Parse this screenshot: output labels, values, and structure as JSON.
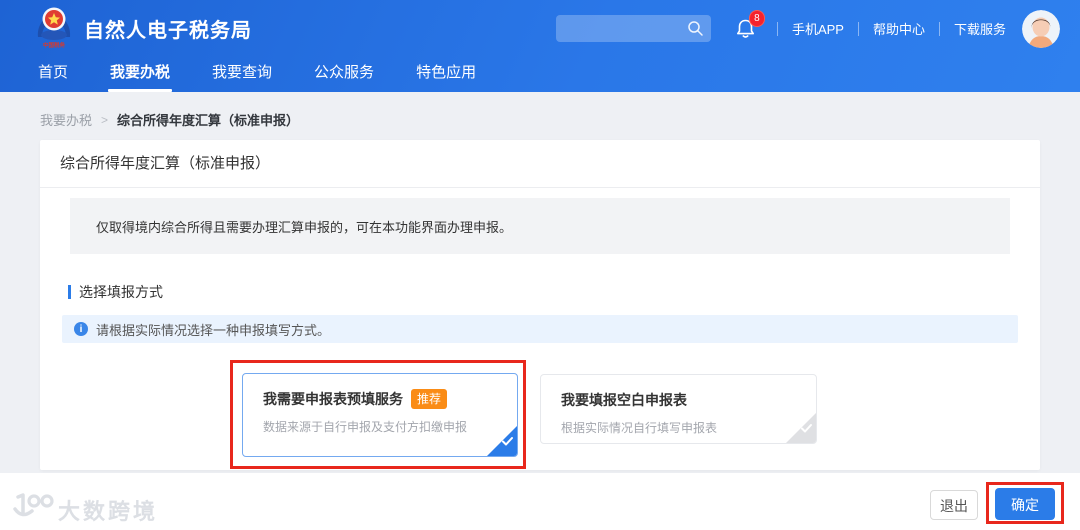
{
  "colors": {
    "header_blue": "#2a77e8",
    "accent_blue": "#2b7ce8",
    "badge_orange": "#fa8c16",
    "notification_red": "#f5222d",
    "annotation_red": "#e8271c",
    "selected_border": "#74a9f0"
  },
  "header": {
    "app_title": "自然人电子税务局",
    "search_placeholder": "",
    "bell_badge_count": "8",
    "links": [
      {
        "label": "手机APP"
      },
      {
        "label": "帮助中心"
      },
      {
        "label": "下载服务"
      }
    ]
  },
  "nav": {
    "items": [
      {
        "label": "首页",
        "active": false
      },
      {
        "label": "我要办税",
        "active": true
      },
      {
        "label": "我要查询",
        "active": false
      },
      {
        "label": "公众服务",
        "active": false
      },
      {
        "label": "特色应用",
        "active": false
      }
    ]
  },
  "breadcrumb": {
    "parent": "我要办税",
    "separator": ">",
    "current": "综合所得年度汇算（标准申报）"
  },
  "main": {
    "card_title": "综合所得年度汇算（标准申报）",
    "notice": "仅取得境内综合所得且需要办理汇算申报的，可在本功能界面办理申报。",
    "section_title": "选择填报方式",
    "tip": "请根据实际情况选择一种申报填写方式。",
    "options": [
      {
        "title": "我需要申报表预填服务",
        "badge": "推荐",
        "desc": "数据来源于自行申报及支付方扣缴申报",
        "selected": true
      },
      {
        "title": "我要填报空白申报表",
        "desc": "根据实际情况自行填写申报表",
        "selected": false
      }
    ]
  },
  "footer": {
    "exit_label": "退出",
    "confirm_label": "确定",
    "watermark": "大数跨境"
  },
  "icons": {
    "search": "magnifier",
    "bell": "notification-bell",
    "info": "info-circle",
    "check": "checkmark",
    "logo": "china-tax-emblem"
  }
}
